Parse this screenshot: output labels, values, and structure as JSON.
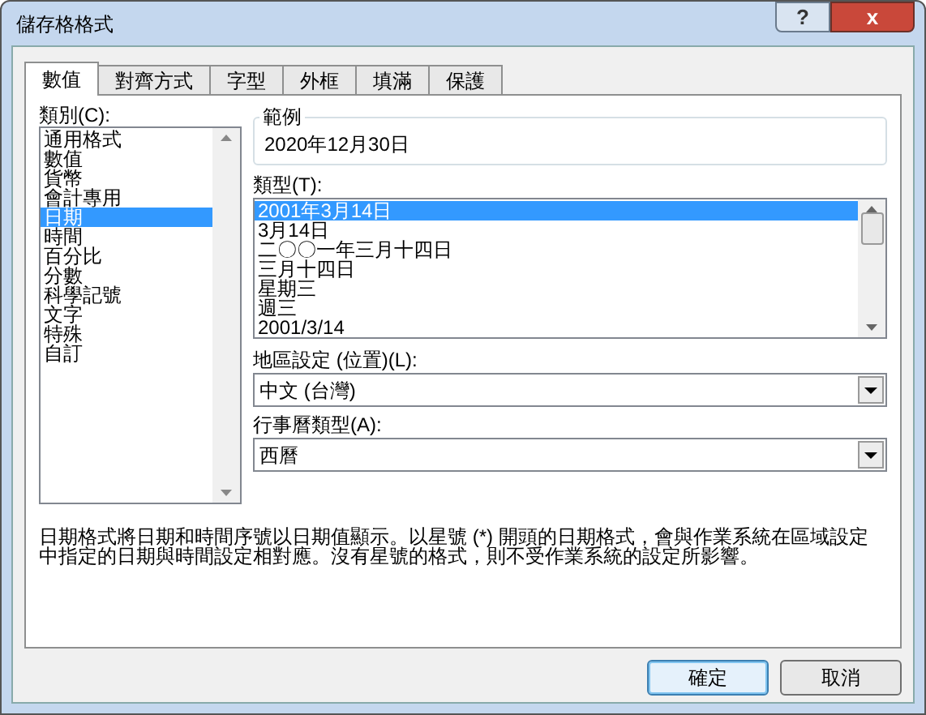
{
  "window": {
    "title": "儲存格格式",
    "help_button": "?",
    "close_button": "x"
  },
  "tabs": [
    {
      "label": "數值",
      "selected": true
    },
    {
      "label": "對齊方式",
      "selected": false
    },
    {
      "label": "字型",
      "selected": false
    },
    {
      "label": "外框",
      "selected": false
    },
    {
      "label": "填滿",
      "selected": false
    },
    {
      "label": "保護",
      "selected": false
    }
  ],
  "category": {
    "label": "類別(C):",
    "items": [
      {
        "label": "通用格式",
        "selected": false
      },
      {
        "label": "數值",
        "selected": false
      },
      {
        "label": "貨幣",
        "selected": false
      },
      {
        "label": "會計專用",
        "selected": false
      },
      {
        "label": "日期",
        "selected": true
      },
      {
        "label": "時間",
        "selected": false
      },
      {
        "label": "百分比",
        "selected": false
      },
      {
        "label": "分數",
        "selected": false
      },
      {
        "label": "科學記號",
        "selected": false
      },
      {
        "label": "文字",
        "selected": false
      },
      {
        "label": "特殊",
        "selected": false
      },
      {
        "label": "自訂",
        "selected": false
      }
    ]
  },
  "sample": {
    "label": "範例",
    "value": "2020年12月30日"
  },
  "type": {
    "label": "類型(T):",
    "items": [
      {
        "label": "2001年3月14日",
        "selected": true
      },
      {
        "label": "3月14日",
        "selected": false
      },
      {
        "label": "二〇〇一年三月十四日",
        "selected": false
      },
      {
        "label": "三月十四日",
        "selected": false
      },
      {
        "label": "星期三",
        "selected": false
      },
      {
        "label": "週三",
        "selected": false
      },
      {
        "label": "2001/3/14",
        "selected": false
      }
    ]
  },
  "locale": {
    "label": "地區設定 (位置)(L):",
    "value": "中文 (台灣)"
  },
  "calendar": {
    "label": "行事曆類型(A):",
    "value": "西曆"
  },
  "description": "日期格式將日期和時間序號以日期值顯示。以星號 (*) 開頭的日期格式，會與作業系統在區域設定中指定的日期與時間設定相對應。沒有星號的格式，則不受作業系統的設定所影響。",
  "buttons": [
    {
      "label": "確定",
      "default": true
    },
    {
      "label": "取消",
      "default": false
    }
  ]
}
